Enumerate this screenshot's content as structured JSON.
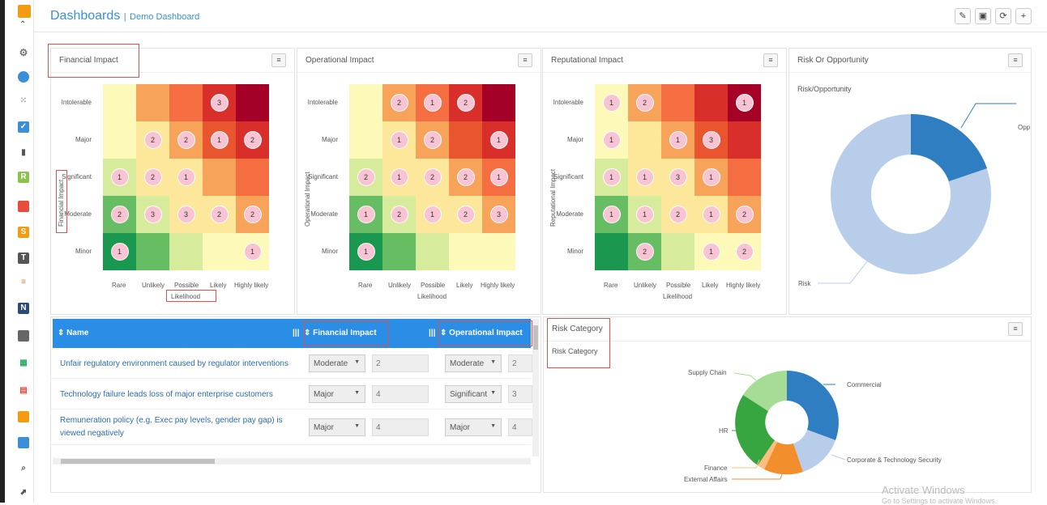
{
  "header": {
    "title": "Dashboards",
    "separator": "|",
    "subtitle": "Demo Dashboard"
  },
  "toolbar": {
    "edit": "✎",
    "pdf": "▣",
    "refresh": "⟳",
    "add": "+"
  },
  "heatmap_common": {
    "rows": [
      "Intolerable",
      "Major",
      "Significant",
      "Moderate",
      "Minor"
    ],
    "cols": [
      "Rare",
      "Unlikely",
      "Possible",
      "Likely",
      "Highly likely"
    ],
    "xlabel": "Likelihood",
    "colors": [
      [
        "#fdf9b9",
        "#f8a35a",
        "#f46e42",
        "#d92f2a",
        "#a50026"
      ],
      [
        "#fdf9b9",
        "#fde79a",
        "#f8a35a",
        "#e8552f",
        "#d92f2a"
      ],
      [
        "#d6eb9c",
        "#fde79a",
        "#fde79a",
        "#f8a35a",
        "#f46e42"
      ],
      [
        "#66bd63",
        "#d6eb9c",
        "#fde79a",
        "#fde79a",
        "#f8a35a"
      ],
      [
        "#1a9850",
        "#66bd63",
        "#d6eb9c",
        "#fdf9b9",
        "#fdf9b9"
      ]
    ]
  },
  "heatmaps": [
    {
      "title": "Financial Impact",
      "ylabel": "Financial Impact",
      "values": [
        [
          null,
          null,
          null,
          "3",
          null
        ],
        [
          null,
          "2",
          "2",
          "1",
          "2"
        ],
        [
          "1",
          "2",
          "1",
          null,
          null
        ],
        [
          "2",
          "3",
          "3",
          "2",
          "2"
        ],
        [
          "1",
          null,
          null,
          null,
          "1"
        ]
      ]
    },
    {
      "title": "Operational Impact",
      "ylabel": "Operational Impact",
      "values": [
        [
          null,
          "2",
          "1",
          "2",
          null
        ],
        [
          null,
          "1",
          "2",
          null,
          "1"
        ],
        [
          "2",
          "1",
          "2",
          "2",
          "1"
        ],
        [
          "1",
          "2",
          "1",
          "2",
          "3"
        ],
        [
          "1",
          null,
          null,
          null,
          null
        ]
      ]
    },
    {
      "title": "Reputational Impact",
      "ylabel": "Reputational Impact",
      "values": [
        [
          "1",
          "2",
          null,
          null,
          "1"
        ],
        [
          "1",
          null,
          "1",
          "3",
          null
        ],
        [
          "1",
          "1",
          "3",
          "1",
          null
        ],
        [
          "1",
          "1",
          "2",
          "1",
          "2"
        ],
        [
          null,
          "2",
          null,
          "1",
          "2"
        ]
      ]
    }
  ],
  "risk_opportunity": {
    "title": "Risk Or Opportunity",
    "subtitle": "Risk/Opportunity",
    "labels": {
      "opp": "Opp",
      "risk": "Risk"
    }
  },
  "table": {
    "headers": [
      "Name",
      "Financial Impact",
      "Operational Impact"
    ],
    "rows": [
      {
        "name": "Unfair regulatory environment caused by regulator interventions",
        "fin": "Moderate",
        "fin_val": "2",
        "op": "Moderate",
        "op_val": "2"
      },
      {
        "name": "Technology failure leads loss of major enterprise customers",
        "fin": "Major",
        "fin_val": "4",
        "op": "Significant",
        "op_val": "3"
      },
      {
        "name": "Remuneration policy (e.g. Exec pay levels, gender pay gap) is viewed negatively",
        "fin": "Major",
        "fin_val": "4",
        "op": "Major",
        "op_val": "4"
      }
    ]
  },
  "risk_category": {
    "title": "Risk Category",
    "subtitle": "Risk Category",
    "labels": {
      "supply": "Supply Chain",
      "commercial": "Commercial",
      "hr": "HR",
      "corp": "Corporate & Technology Security",
      "finance": "Finance",
      "external": "External Affairs"
    }
  },
  "watermark": {
    "line1": "Activate Windows",
    "line2": "Go to Settings to activate Windows."
  }
}
